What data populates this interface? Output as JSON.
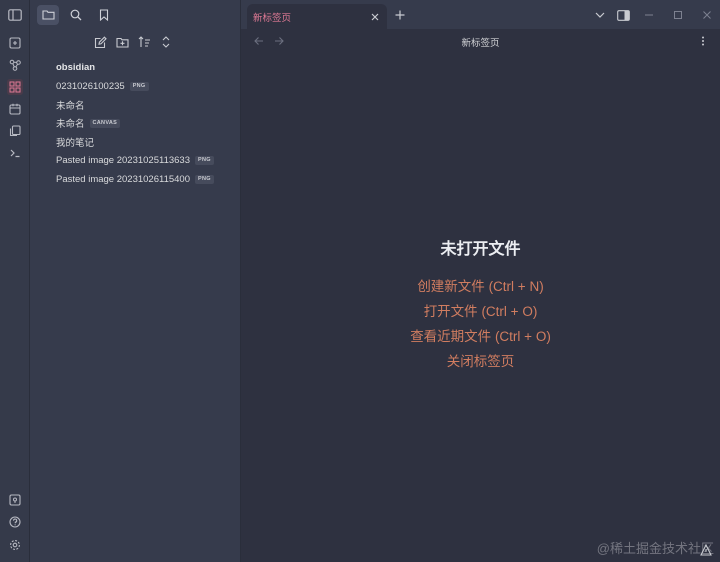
{
  "colors": {
    "accent": "#e07a95",
    "link": "#d17d60",
    "background": "#2e3140",
    "sidebar": "#363b4c"
  },
  "ribbon": {
    "icons": [
      "sidebar-toggle-icon",
      "open-quick-switcher-icon",
      "graph-view-icon",
      "canvas-icon",
      "daily-note-icon",
      "templates-icon",
      "command-palette-icon",
      "help-icon",
      "vault-icon",
      "settings-icon"
    ]
  },
  "sidebar": {
    "top_icons": [
      "folder-icon",
      "search-icon",
      "bookmark-icon"
    ],
    "file_actions": [
      "new-note-icon",
      "new-folder-icon",
      "sort-icon",
      "collapse-icon"
    ],
    "tree": {
      "vault": "obsidian",
      "files": [
        {
          "name": "0231026100235",
          "badge": "PNG"
        },
        {
          "name": "未命名",
          "badge": ""
        },
        {
          "name": "未命名",
          "badge": "CANVAS"
        },
        {
          "name": "我的笔记",
          "badge": ""
        },
        {
          "name": "Pasted image 20231025113633",
          "badge": "PNG"
        },
        {
          "name": "Pasted image 20231026115400",
          "badge": "PNG"
        }
      ]
    }
  },
  "tabs": [
    {
      "title": "新标签页",
      "active": true
    }
  ],
  "main": {
    "heading": "新标签页",
    "empty_title": "未打开文件",
    "actions": [
      "创建新文件 (Ctrl + N)",
      "打开文件 (Ctrl + O)",
      "查看近期文件 (Ctrl + O)",
      "关闭标签页"
    ]
  },
  "watermark": "@稀土掘金技术社区"
}
